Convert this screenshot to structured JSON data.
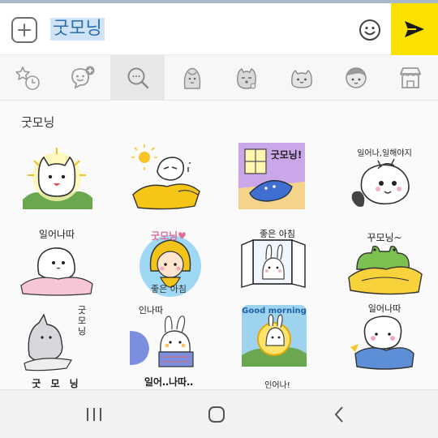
{
  "input": {
    "text": "굿모닝"
  },
  "icons": {
    "add": "plus-icon",
    "emoji": "smiley-icon",
    "send": "send-arrow-icon"
  },
  "colors": {
    "send_button": "#fae100",
    "selection_highlight": "#cfe2f6",
    "selected_text": "#2a6fb0"
  },
  "tabs": [
    {
      "icon": "favorites-recent-icon",
      "active": false
    },
    {
      "icon": "emoticon-add-icon",
      "active": false
    },
    {
      "icon": "search-icon",
      "active": true
    },
    {
      "icon": "sticker-pack-1-thumb",
      "active": false
    },
    {
      "icon": "sticker-pack-2-thumb",
      "active": false
    },
    {
      "icon": "sticker-pack-3-thumb",
      "active": false
    },
    {
      "icon": "sticker-pack-4-thumb",
      "active": false
    },
    {
      "icon": "store-icon",
      "active": false
    }
  ],
  "search_results": {
    "title": "굿모닝",
    "stickers": [
      {
        "name": "sun-cat-sticker",
        "text": ""
      },
      {
        "name": "sleepy-blanket-sticker",
        "text": ""
      },
      {
        "name": "waking-window-sticker",
        "text": "굿모닝!"
      },
      {
        "name": "get-up-bug-sticker",
        "text": "일어나,일해야지"
      },
      {
        "name": "ghost-blanket-sticker",
        "text": "일어나따"
      },
      {
        "name": "raincoat-girl-sticker",
        "text": "굿모닝♥",
        "text2": "좋은 아침"
      },
      {
        "name": "bunny-window-sticker",
        "text": "좋은 아침"
      },
      {
        "name": "frog-blanket-sticker",
        "text": "꾸모닝~"
      },
      {
        "name": "gray-cat-sticker",
        "text": "굿모닝"
      },
      {
        "name": "bunny-bed-sticker",
        "text": "인나따"
      },
      {
        "name": "sunrise-bunny-sticker",
        "text": "Good morning"
      },
      {
        "name": "sheep-bed-sticker",
        "text": "일어나따"
      },
      {
        "name": "row4-sticker-1",
        "text": "굿 모 닝"
      },
      {
        "name": "row4-sticker-2",
        "text": "일어‥나따‥"
      },
      {
        "name": "row4-sticker-3",
        "text": "인어나!"
      }
    ]
  },
  "navbar": {
    "recent": "recent-apps-icon",
    "home": "home-icon",
    "back": "back-icon"
  }
}
